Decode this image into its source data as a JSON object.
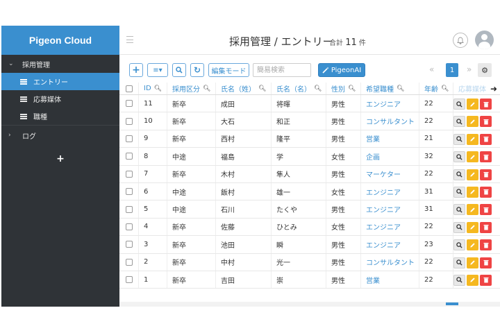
{
  "sidebar": {
    "brand": "Pigeon Cloud",
    "group_label": "採用管理",
    "items": [
      {
        "label": "エントリー",
        "active": true
      },
      {
        "label": "応募媒体",
        "active": false
      },
      {
        "label": "職種",
        "active": false
      }
    ],
    "log_label": "ログ",
    "add_glyph": "+"
  },
  "header": {
    "title": "採用管理 / エントリー",
    "total_prefix": "合計",
    "total_count": "11",
    "total_suffix": "件"
  },
  "toolbar": {
    "add_glyph": "+",
    "menu_glyph": "≡▾",
    "search_glyph": "⌕",
    "refresh_glyph": "↻",
    "edit_mode_label": "編集モード",
    "search_placeholder": "簡易検索",
    "ai_label": "PigeonAI",
    "prev_glyph": "«",
    "page_number": "1",
    "next_glyph": "»",
    "settings_glyph": "⚙"
  },
  "table": {
    "columns": [
      "ID",
      "採用区分",
      "氏名（姓）",
      "氏名（名）",
      "性別",
      "希望職種",
      "年齢",
      "応募媒体"
    ],
    "rows": [
      {
        "id": "11",
        "type": "新卒",
        "last": "成田",
        "first": "将暉",
        "gender": "男性",
        "job": "エンジニア",
        "age": "22"
      },
      {
        "id": "10",
        "type": "新卒",
        "last": "大石",
        "first": "和正",
        "gender": "男性",
        "job": "コンサルタント",
        "age": "22"
      },
      {
        "id": "9",
        "type": "新卒",
        "last": "西村",
        "first": "隆平",
        "gender": "男性",
        "job": "営業",
        "age": "21"
      },
      {
        "id": "8",
        "type": "中途",
        "last": "福島",
        "first": "学",
        "gender": "女性",
        "job": "企画",
        "age": "32"
      },
      {
        "id": "7",
        "type": "新卒",
        "last": "木村",
        "first": "隼人",
        "gender": "男性",
        "job": "マーケター",
        "age": "22"
      },
      {
        "id": "6",
        "type": "中途",
        "last": "飯村",
        "first": "雄一",
        "gender": "女性",
        "job": "エンジニア",
        "age": "31"
      },
      {
        "id": "5",
        "type": "中途",
        "last": "石川",
        "first": "たくや",
        "gender": "男性",
        "job": "エンジニア",
        "age": "31"
      },
      {
        "id": "4",
        "type": "新卒",
        "last": "佐藤",
        "first": "ひとみ",
        "gender": "女性",
        "job": "エンジニア",
        "age": "22"
      },
      {
        "id": "3",
        "type": "新卒",
        "last": "池田",
        "first": "瞬",
        "gender": "男性",
        "job": "エンジニア",
        "age": "23"
      },
      {
        "id": "2",
        "type": "新卒",
        "last": "中村",
        "first": "光一",
        "gender": "男性",
        "job": "コンサルタント",
        "age": "22"
      },
      {
        "id": "1",
        "type": "新卒",
        "last": "吉田",
        "first": "崇",
        "gender": "男性",
        "job": "営業",
        "age": "22"
      }
    ]
  },
  "colors": {
    "accent": "#3a8fcf",
    "sidebar_bg": "#2f3337",
    "edit": "#f5b820",
    "delete": "#ef4444"
  },
  "icons": [
    "bars-icon",
    "search-icon",
    "refresh-icon",
    "magic-wand-icon",
    "bell-icon",
    "avatar-icon",
    "gear-icon",
    "view-icon",
    "pencil-icon",
    "trash-icon"
  ]
}
